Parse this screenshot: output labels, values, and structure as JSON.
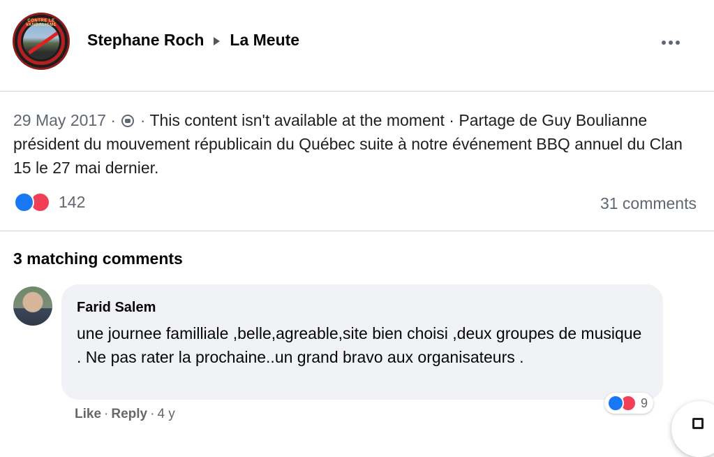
{
  "header": {
    "author": "Stephane Roch",
    "group": "La Meute",
    "avatar_ring_text": "CONTRE LE VANDALISME"
  },
  "post": {
    "date": "29 May 2017",
    "sep1": " · ",
    "sep2": " · ",
    "body": "This content isn't available at the moment · Partage de Guy Boulianne président du mouvement républicain du Québec suite à notre événement BBQ annuel du Clan 15 le 27 mai dernier.",
    "reaction_count": "142",
    "comments_count": "31 comments"
  },
  "comments_section": {
    "title": "3 matching comments"
  },
  "comment": {
    "author": "Farid Salem",
    "text": "une journee familliale ,belle,agreable,site bien choisi ,deux groupes de musique . Ne pas rater la prochaine..un grand bravo aux organisateurs .",
    "reaction_count": "9",
    "like_label": "Like",
    "reply_label": "Reply",
    "dot": "·",
    "age": "4 y"
  },
  "colors": {
    "like_blue": "#1877f2",
    "heart_red": "#f33e58",
    "muted_text": "#606770",
    "bubble_bg": "#f0f2f5"
  },
  "icons": [
    "globe-icon",
    "more-options-icon",
    "like-reaction-icon",
    "love-reaction-icon",
    "compose-icon"
  ]
}
